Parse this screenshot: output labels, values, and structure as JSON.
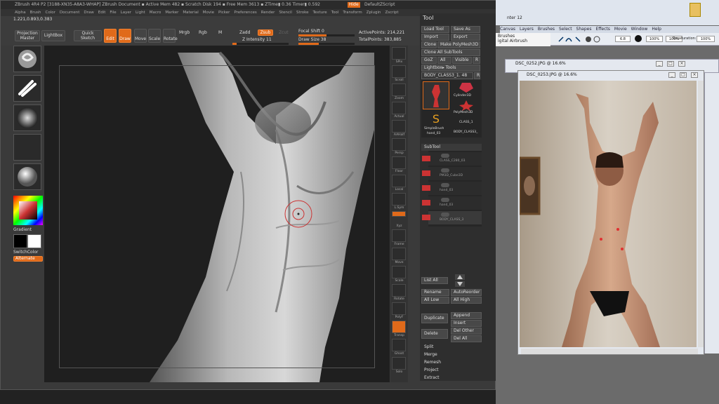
{
  "zbrush": {
    "title": "ZBrush 4R4 P2   [3188-XN35-A8A3-WHAP]   ZBrush Document   ▪ Active Mem 482 ▪ Scratch Disk 194 ▪ Free Mem 3613 ▪ ZTime▮ 0.36  Timer▮ 0.592",
    "title_hide": "Hide",
    "title_script": "DefaultZScript",
    "menus": [
      "Alpha",
      "Brush",
      "Color",
      "Document",
      "Draw",
      "Edit",
      "File",
      "Layer",
      "Light",
      "Macro",
      "Marker",
      "Material",
      "Movie",
      "Picker",
      "Preferences",
      "Render",
      "Stencil",
      "Stroke",
      "Texture",
      "Tool",
      "Transform",
      "Zplugin",
      "Zscript"
    ],
    "coords": "1.221,0.893,0.383",
    "toolbar": {
      "projection_master": "Projection Master",
      "lightbox": "LightBox",
      "quick_sketch": "Quick Sketch",
      "edit": "Edit",
      "draw": "Draw",
      "move": "Move",
      "scale": "Scale",
      "rotate": "Rotate",
      "mrgb": "Mrgb",
      "rgb": "Rgb",
      "m": "M",
      "zadd": "Zadd",
      "zsub": "Zsub",
      "zcut": "Zcut",
      "z_intensity": "Z Intensity 11",
      "focal_shift": "Focal Shift 0",
      "draw_size": "Draw Size 38",
      "active_points": "ActivePoints: 214,221",
      "total_points": "TotalPoints: 383,885"
    },
    "left_tray": {
      "gradient": "Gradient",
      "switch_color": "SwitchColor",
      "alternate": "Alternate"
    },
    "shelf": [
      "SPix",
      "Scroll",
      "Zoom",
      "Actual",
      "AAHalf",
      "Persp",
      "Floor",
      "Local",
      "L.Sym",
      "Xyz",
      "Frame",
      "Move",
      "Scale",
      "Rotate",
      "PolyF",
      "Transp",
      "Ghost",
      "Solo"
    ],
    "tool_panel": {
      "title": "Tool",
      "load_tool": "Load Tool",
      "save_as": "Save As",
      "import": "Import",
      "export": "Export",
      "clone": "Clone",
      "make_polymesh": "Make PolyMesh3D",
      "clone_all_subtools": "Clone All SubTools",
      "goz": "GoZ",
      "all": "All",
      "visible": "Visible",
      "r": "R",
      "lightbox_tools": "Lightbox▸ Tools",
      "current_tool": "BODY_CLASS3_1. 48",
      "thumbs": [
        "Cylinder3D",
        "PolyMesh3D",
        "SimpleBrush",
        "CLASS_1",
        "hand_03",
        "BODY_CLASS3_"
      ],
      "subtool_header": "SubTool",
      "subtools": [
        "CLASS_C280_03",
        "PM3D_Cube3D",
        "hand_03",
        "hand_03",
        "BODY_CLASS_3"
      ],
      "list_all": "List All",
      "rename": "Rename",
      "auto_reorder": "AutoReorder",
      "all_low": "All Low",
      "all_high": "All High",
      "duplicate": "Duplicate",
      "append": "Append",
      "insert": "Insert",
      "delete": "Delete",
      "del_other": "Del Other",
      "del_all": "Del All",
      "split": "Split",
      "merge": "Merge",
      "remesh": "Remesh",
      "project": "Project",
      "extract": "Extract"
    }
  },
  "photoshop": {
    "window_title_frag": "nter 12",
    "menus": [
      "Canvas",
      "Layers",
      "Brushes",
      "Select",
      "Shapes",
      "Effects",
      "Movie",
      "Window",
      "Help"
    ],
    "brushes_label": "Brushes",
    "tool_name": "igital Airbrush",
    "opacity": "100%",
    "flow": "100%",
    "size": "6.8",
    "resaturation_label": "Resaturation:",
    "resaturation": "100%",
    "doc1_title": "DSC_0252.JPG @ 16.6%",
    "doc2_title": "DSC_0253.JPG @ 16.6%"
  }
}
